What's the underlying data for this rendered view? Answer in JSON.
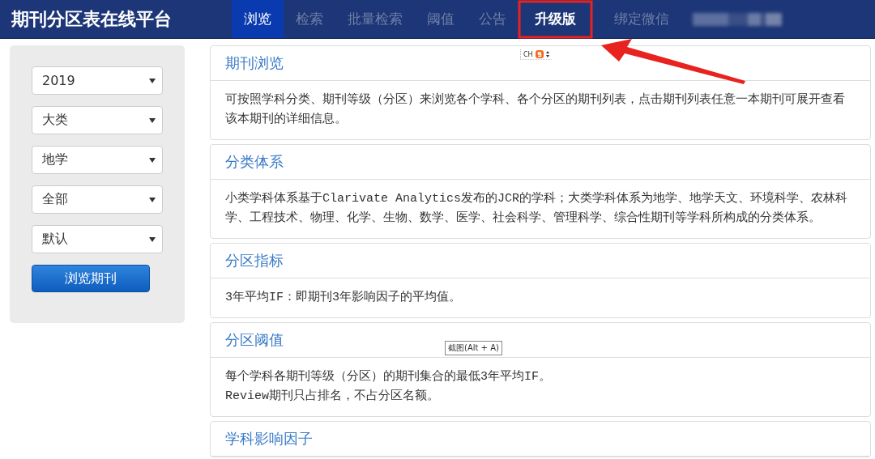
{
  "header": {
    "title": "期刊分区表在线平台",
    "tabs": [
      {
        "label": "浏览",
        "selected": true,
        "emphasized": false
      },
      {
        "label": "检索",
        "selected": false,
        "emphasized": false
      },
      {
        "label": "批量检索",
        "selected": false,
        "emphasized": false
      },
      {
        "label": "阈值",
        "selected": false,
        "emphasized": false
      },
      {
        "label": "公告",
        "selected": false,
        "emphasized": false
      },
      {
        "label": "升级版",
        "selected": false,
        "emphasized": true
      },
      {
        "label": "绑定微信",
        "selected": false,
        "emphasized": false
      }
    ]
  },
  "sidebar": {
    "selects": [
      "2019",
      "大类",
      "地学",
      "全部",
      "默认"
    ],
    "button": "浏览期刊"
  },
  "panels": [
    {
      "heading": "期刊浏览",
      "paragraphs": [
        "可按照学科分类、期刊等级（分区）来浏览各个学科、各个分区的期刊列表，点击期刊列表任意一本期刊可展开查看该本期刊的详细信息。"
      ]
    },
    {
      "heading": "分类体系",
      "paragraphs": [
        "小类学科体系基于Clarivate Analytics发布的JCR的学科；大类学科体系为地学、地学天文、环境科学、农林科学、工程技术、物理、化学、生物、数学、医学、社会科学、管理科学、综合性期刊等学科所构成的分类体系。"
      ]
    },
    {
      "heading": "分区指标",
      "paragraphs": [
        "3年平均IF：即期刊3年影响因子的平均值。"
      ]
    },
    {
      "heading": "分区阈值",
      "paragraphs": [
        "每个学科各期刊等级（分区）的期刊集合的最低3年平均IF。",
        "Review期刊只占排名，不占分区名额。"
      ]
    },
    {
      "heading": "学科影响因子"
    }
  ],
  "ime_toolbar": {
    "label": "CH"
  },
  "tooltip": "截图(Alt + A)"
}
